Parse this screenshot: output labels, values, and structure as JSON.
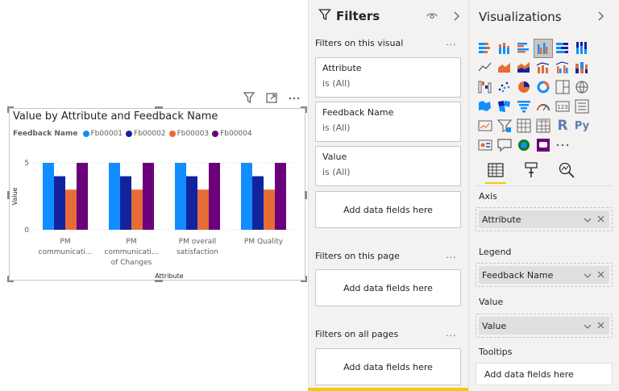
{
  "visual": {
    "title": "Value by Attribute and Feedback Name",
    "legend_title": "Feedback Name",
    "legend_items": [
      {
        "label": "Fb00001",
        "color": "#118DFF"
      },
      {
        "label": "Fb00002",
        "color": "#12239E"
      },
      {
        "label": "Fb00003",
        "color": "#E66C37"
      },
      {
        "label": "Fb00004",
        "color": "#6B007B"
      }
    ],
    "toolbar_icons": [
      "filter-icon",
      "focus-mode-icon",
      "more-options-icon"
    ]
  },
  "chart_data": {
    "type": "bar",
    "categories": [
      "PM communicati...",
      "PM communicati... of Changes",
      "PM overall satisfaction",
      "PM Quality"
    ],
    "category_lines": [
      [
        "PM",
        "communicati..."
      ],
      [
        "PM",
        "communicati...",
        "of Changes"
      ],
      [
        "PM overall",
        "satisfaction"
      ],
      [
        "PM Quality"
      ]
    ],
    "series": [
      {
        "name": "Fb00001",
        "values": [
          5,
          5,
          5,
          5
        ]
      },
      {
        "name": "Fb00002",
        "values": [
          4,
          4,
          4,
          4
        ]
      },
      {
        "name": "Fb00003",
        "values": [
          3,
          3,
          3,
          3
        ]
      },
      {
        "name": "Fb00004",
        "values": [
          5,
          5,
          5,
          5
        ]
      }
    ],
    "xlabel": "Attribute",
    "ylabel": "Value",
    "ylim": [
      0,
      5
    ],
    "yticks": [
      "0",
      "5"
    ],
    "grid": true,
    "legend_position": "top-left"
  },
  "filters": {
    "title": "Filters",
    "on_visual": "Filters on this visual",
    "on_page": "Filters on this page",
    "on_all_pages": "Filters on all pages",
    "more": "...",
    "cards": [
      {
        "name": "Attribute",
        "value": "is (All)"
      },
      {
        "name": "Feedback Name",
        "value": "is (All)"
      },
      {
        "name": "Value",
        "value": "is (All)"
      }
    ],
    "add_fields": "Add data fields here"
  },
  "visualizations": {
    "title": "Visualizations",
    "more": "...",
    "icons": [
      "stacked-bar-icon",
      "stacked-column-icon",
      "clustered-bar-icon",
      "clustered-column-icon",
      "100-stacked-bar-icon",
      "100-stacked-column-icon",
      "line-chart-icon",
      "area-chart-icon",
      "stacked-area-icon",
      "line-column-icon",
      "line-clustered-column-icon",
      "ribbon-chart-icon",
      "waterfall-icon",
      "scatter-icon",
      "pie-chart-icon",
      "donut-chart-icon",
      "treemap-icon",
      "map-icon",
      "filled-map-icon",
      "shape-map-icon",
      "funnel-icon",
      "gauge-icon",
      "card-icon",
      "multi-row-card-icon",
      "kpi-icon",
      "slicer-icon",
      "table-icon",
      "matrix-icon",
      "r-visual-icon",
      "python-visual-icon",
      "key-influencers-icon",
      "qna-icon",
      "arcgis-icon",
      "power-apps-icon",
      "more-visuals-icon"
    ],
    "r_label": "R",
    "py_label": "Py",
    "tabs": [
      "fields-tab-icon",
      "format-tab-icon",
      "analytics-tab-icon"
    ],
    "wells": {
      "axis": {
        "title": "Axis",
        "field": "Attribute"
      },
      "legend": {
        "title": "Legend",
        "field": "Feedback Name"
      },
      "value": {
        "title": "Value",
        "field": "Value"
      },
      "tooltips": {
        "title": "Tooltips",
        "add": "Add data fields here"
      }
    }
  }
}
